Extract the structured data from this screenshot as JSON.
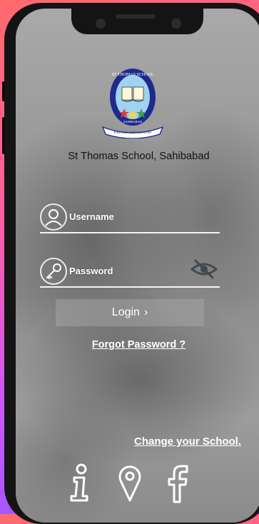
{
  "school": {
    "name": "St Thomas School, Sahibabad",
    "logo_text_top": "ST THOMAS SCHOOL",
    "logo_text_side": "SAHIBABAD",
    "logo_motto": "FOR GOD AND COUNTRY"
  },
  "form": {
    "username_label": "Username",
    "password_label": "Password",
    "login_label": "Login",
    "login_chevron": "›",
    "forgot_link": "Forgot Password ?"
  },
  "footer": {
    "change_school_link": "Change your School."
  },
  "icons": {
    "username": "user-icon",
    "password": "key-icon",
    "toggle": "eye-off-icon",
    "info": "info-icon",
    "location": "location-pin-icon",
    "facebook": "facebook-icon"
  },
  "colors": {
    "accent_text": "#ffffff",
    "logo_border": "#1f2a8c"
  }
}
